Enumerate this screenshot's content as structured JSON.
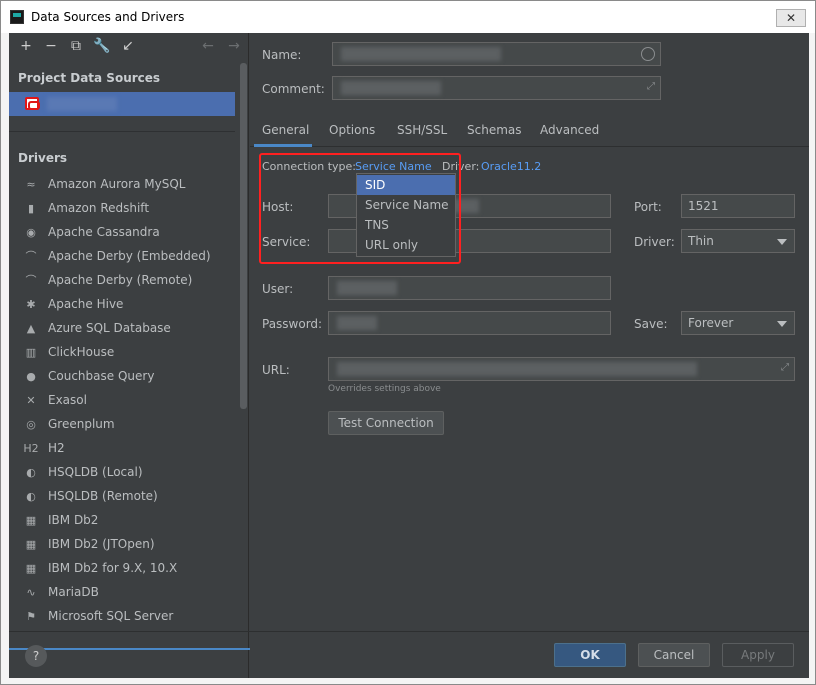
{
  "window": {
    "title": "Data Sources and Drivers",
    "close_glyph": "✕"
  },
  "sidebar": {
    "toolbar": [
      {
        "name": "add-icon",
        "glyph": "+",
        "dim": false
      },
      {
        "name": "remove-icon",
        "glyph": "−",
        "dim": false
      },
      {
        "name": "duplicate-icon",
        "glyph": "⧉",
        "dim": false
      },
      {
        "name": "wrench-icon",
        "glyph": "🔧",
        "dim": false
      },
      {
        "name": "import-icon",
        "glyph": "↙",
        "dim": false
      },
      {
        "name": "back-icon",
        "glyph": "←",
        "dim": true
      },
      {
        "name": "forward-icon",
        "glyph": "→",
        "dim": true
      }
    ],
    "project_title": "Project Data Sources",
    "drivers_title": "Drivers",
    "drivers": [
      {
        "label": "Amazon Aurora MySQL",
        "icon": "dolphin-icon",
        "glyph": "≈"
      },
      {
        "label": "Amazon Redshift",
        "icon": "redshift-icon",
        "glyph": "▮"
      },
      {
        "label": "Apache Cassandra",
        "icon": "eye-icon",
        "glyph": "◉"
      },
      {
        "label": "Apache Derby (Embedded)",
        "icon": "hat-icon",
        "glyph": "⌒"
      },
      {
        "label": "Apache Derby (Remote)",
        "icon": "hat-icon",
        "glyph": "⌒"
      },
      {
        "label": "Apache Hive",
        "icon": "bee-icon",
        "glyph": "✱"
      },
      {
        "label": "Azure SQL Database",
        "icon": "azure-icon",
        "glyph": "▲"
      },
      {
        "label": "ClickHouse",
        "icon": "bars-icon",
        "glyph": "▥"
      },
      {
        "label": "Couchbase Query",
        "icon": "couchbase-icon",
        "glyph": "●"
      },
      {
        "label": "Exasol",
        "icon": "x-icon",
        "glyph": "✕"
      },
      {
        "label": "Greenplum",
        "icon": "greenplum-icon",
        "glyph": "◎"
      },
      {
        "label": "H2",
        "icon": "h2-icon",
        "glyph": "H2"
      },
      {
        "label": "HSQLDB (Local)",
        "icon": "hsqldb-icon",
        "glyph": "◐"
      },
      {
        "label": "HSQLDB (Remote)",
        "icon": "hsqldb-icon",
        "glyph": "◐"
      },
      {
        "label": "IBM Db2",
        "icon": "ibm-db2-icon",
        "glyph": "▦"
      },
      {
        "label": "IBM Db2 (JTOpen)",
        "icon": "ibm-db2-icon",
        "glyph": "▦"
      },
      {
        "label": "IBM Db2 for 9.X, 10.X",
        "icon": "ibm-db2-icon",
        "glyph": "▦"
      },
      {
        "label": "MariaDB",
        "icon": "seal-icon",
        "glyph": "∿"
      },
      {
        "label": "Microsoft SQL Server",
        "icon": "sqlserver-icon",
        "glyph": "⚑"
      }
    ],
    "help_glyph": "?"
  },
  "form": {
    "name_label": "Name:",
    "comment_label": "Comment:",
    "tabs": [
      "General",
      "Options",
      "SSH/SSL",
      "Schemas",
      "Advanced"
    ],
    "connection_type_label": "Connection type:",
    "connection_type_value": "Service Name",
    "driver_inline_label": "Driver:",
    "driver_inline_value": "Oracle11.2",
    "conn_type_options": [
      {
        "label": "SID",
        "selected": true
      },
      {
        "label": "Service Name",
        "selected": false
      },
      {
        "label": "TNS",
        "selected": false
      },
      {
        "label": "URL only",
        "selected": false
      }
    ],
    "host_label": "Host:",
    "port_label": "Port:",
    "port_value": "1521",
    "service_label": "Service:",
    "driver_label": "Driver:",
    "driver_value": "Thin",
    "user_label": "User:",
    "password_label": "Password:",
    "save_label": "Save:",
    "save_value": "Forever",
    "url_label": "URL:",
    "url_note": "Overrides settings above",
    "test_connection_label": "Test Connection"
  },
  "footer": {
    "ok": "OK",
    "cancel": "Cancel",
    "apply": "Apply"
  }
}
